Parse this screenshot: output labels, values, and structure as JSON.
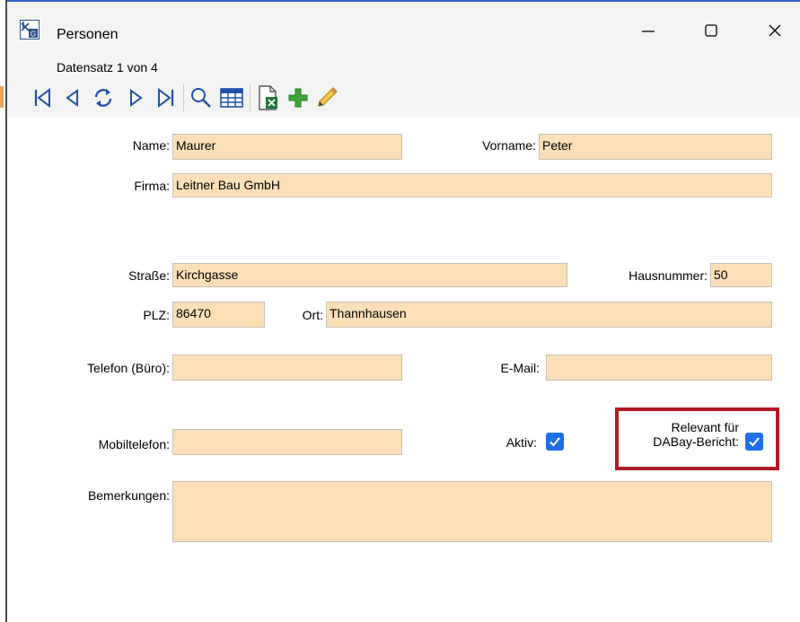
{
  "window": {
    "title": "Personen",
    "record_info": "Datensatz 1 von 4"
  },
  "toolbar": {
    "icons": [
      "first-record-icon",
      "previous-record-icon",
      "refresh-icon",
      "next-record-icon",
      "last-record-icon",
      "search-icon",
      "table-view-icon",
      "excel-export-icon",
      "add-record-icon",
      "edit-icon"
    ]
  },
  "form": {
    "name": {
      "label": "Name:",
      "value": "Maurer"
    },
    "vorname": {
      "label": "Vorname:",
      "value": "Peter"
    },
    "firma": {
      "label": "Firma:",
      "value": "Leitner Bau GmbH"
    },
    "strasse": {
      "label": "Straße:",
      "value": "Kirchgasse"
    },
    "hausnummer": {
      "label": "Hausnummer:",
      "value": "50"
    },
    "plz": {
      "label": "PLZ:",
      "value": "86470"
    },
    "ort": {
      "label": "Ort:",
      "value": "Thannhausen"
    },
    "telefon": {
      "label": "Telefon (Büro):",
      "value": ""
    },
    "email": {
      "label": "E-Mail:",
      "value": ""
    },
    "mobil": {
      "label": "Mobiltelefon:",
      "value": ""
    },
    "aktiv": {
      "label": "Aktiv:",
      "checked": true
    },
    "relevant": {
      "label_line1": "Relevant für",
      "label_line2": "DABay-Bericht:",
      "checked": true
    },
    "bemerkungen": {
      "label": "Bemerkungen:",
      "value": ""
    }
  },
  "colors": {
    "field_bg": "#fcdfb7",
    "checkbox": "#1e6fe6",
    "highlight": "#b01c24"
  }
}
